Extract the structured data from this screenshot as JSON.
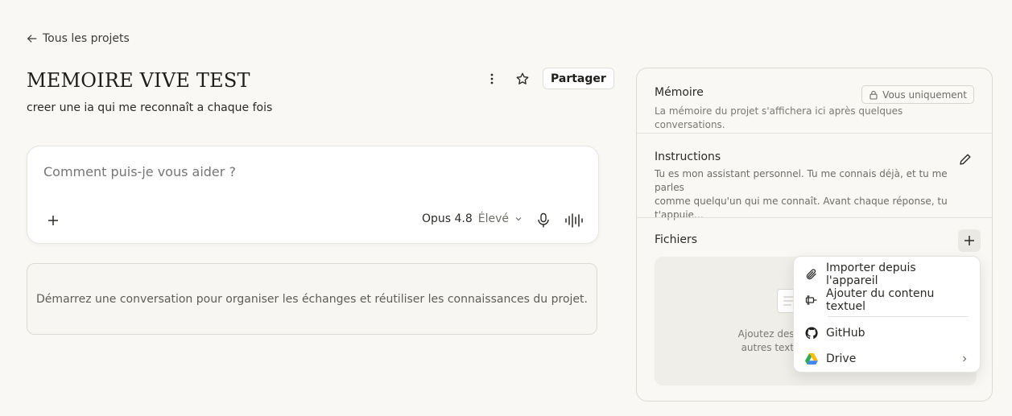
{
  "nav": {
    "back_label": "Tous les projets"
  },
  "project": {
    "title": "MEMOIRE VIVE TEST",
    "description": "creer une ia qui me reconnaît a chaque fois",
    "share_label": "Partager"
  },
  "composer": {
    "placeholder": "Comment puis-je vous aider ?",
    "model_name": "Opus 4.8",
    "model_effort": "Élevé"
  },
  "empty_state": "Démarrez une conversation pour organiser les échanges et réutiliser les connaissances du projet.",
  "panel": {
    "memory": {
      "title": "Mémoire",
      "badge": "Vous uniquement",
      "text": "La mémoire du projet s'affichera ici après quelques conversations."
    },
    "instructions": {
      "title": "Instructions",
      "line1": "Tu es mon assistant personnel. Tu me connais déjà, et tu me parles",
      "line2": "comme quelqu'un qui me connaît. Avant chaque réponse, tu t'appuie…"
    },
    "files": {
      "title": "Fichiers",
      "drop_line1": "Ajoutez des F",
      "drop_line2": "autres texte"
    }
  },
  "menu": {
    "items": [
      {
        "label": "Importer depuis l'appareil",
        "icon": "paperclip-icon"
      },
      {
        "label": "Ajouter du contenu textuel",
        "icon": "text-content-icon"
      },
      {
        "label": "GitHub",
        "icon": "github-icon"
      },
      {
        "label": "Drive",
        "icon": "google-drive-icon"
      }
    ]
  }
}
